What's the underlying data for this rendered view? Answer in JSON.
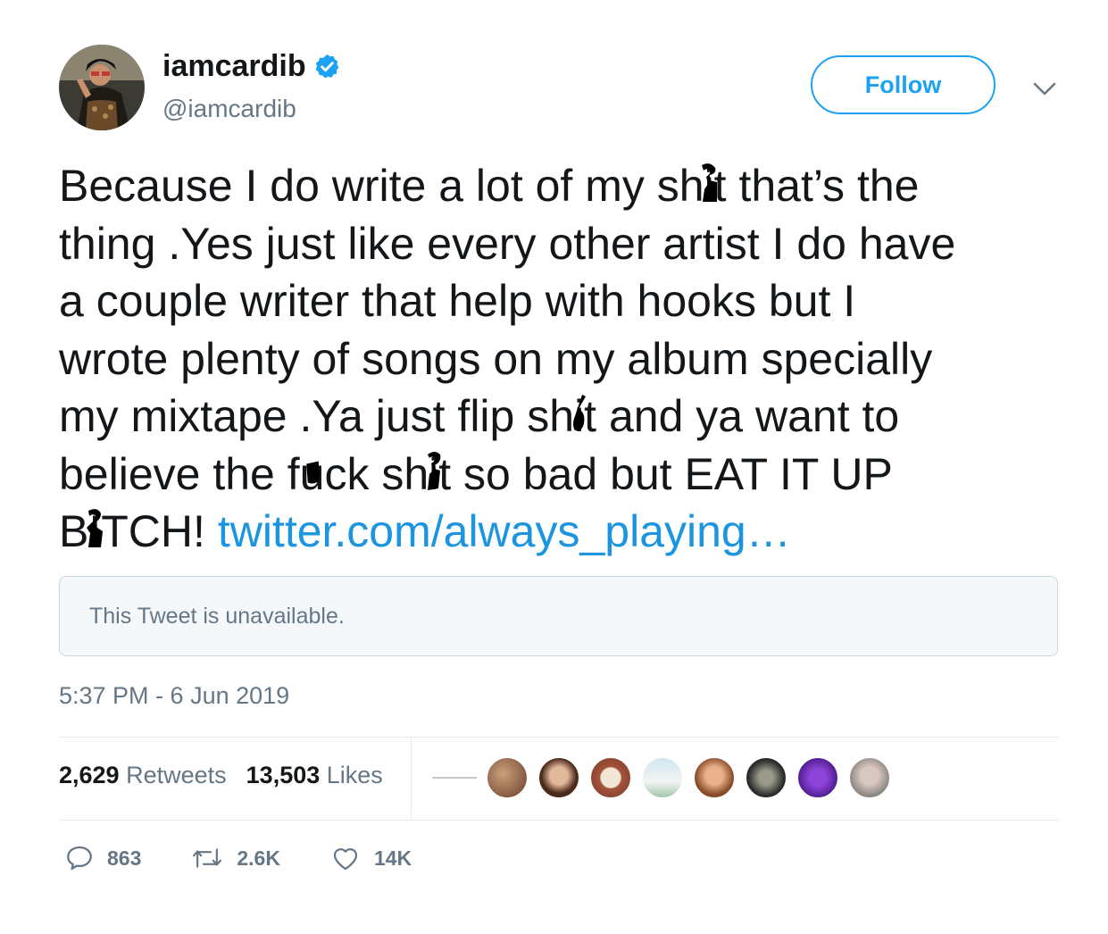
{
  "author": {
    "display_name": "iamcardib",
    "handle": "@iamcardib",
    "verified": true
  },
  "follow_label": "Follow",
  "tweet": {
    "l1a": "Because I do write a lot of my sh",
    "l1b": "t that’s the",
    "l2": "thing .Yes just like every other artist I do have",
    "l3": "a couple writer that help with hooks but I",
    "l4": "wrote plenty of songs on my album specially",
    "l5a": "my mixtape .Ya just flip sh",
    "l5b": "t and ya want to",
    "l6a": "believe the f",
    "l6b": "ck sh",
    "l6c": "t so bad but EAT IT UP",
    "l7a": "B",
    "l7b": "TCH! ",
    "link": "twitter.com/always_playing…"
  },
  "quoted_tweet": "This Tweet is unavailable.",
  "timestamp": "5:37 PM - 6 Jun 2019",
  "stats": {
    "retweets_count": "2,629",
    "retweets_label": "Retweets",
    "likes_count": "13,503",
    "likes_label": "Likes"
  },
  "actions": {
    "replies": "863",
    "retweets": "2.6K",
    "likes": "14K"
  },
  "colors": {
    "accent": "#1da1f2",
    "link": "#1b95e0",
    "muted": "#657786"
  }
}
